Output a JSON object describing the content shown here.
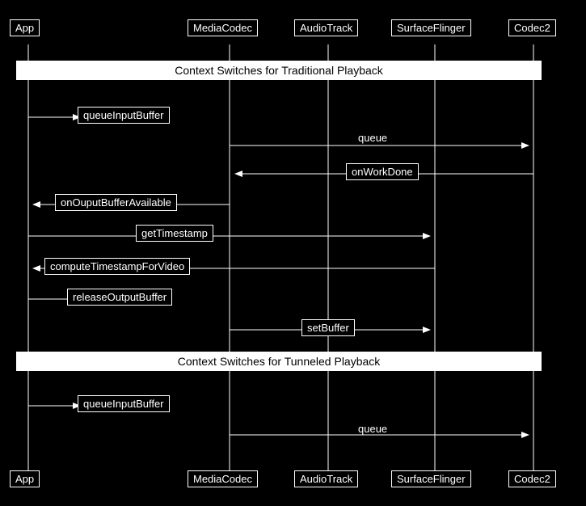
{
  "header": {
    "app": "App",
    "mediacodec": "MediaCodec",
    "audiotrack": "AudioTrack",
    "surfaceflinger": "SurfaceFlinger",
    "codec2": "Codec2"
  },
  "footer": {
    "app": "App",
    "mediacodec": "MediaCodec",
    "audiotrack": "AudioTrack",
    "surfaceflinger": "SurfaceFlinger",
    "codec2": "Codec2"
  },
  "section1": {
    "title": "Context Switches for Traditional Playback"
  },
  "section2": {
    "title": "Context Switches for Tunneled Playback"
  },
  "labels": {
    "queueInputBuffer1": "queueInputBuffer",
    "queue1": "queue",
    "onWorkDone": "onWorkDone",
    "onOuputBufferAvailable": "onOuputBufferAvailable",
    "getTimestamp": "getTimestamp",
    "computeTimestampForVideo": "computeTimestampForVideo",
    "releaseOutputBuffer": "releaseOutputBuffer",
    "setBuffer": "setBuffer",
    "queueInputBuffer2": "queueInputBuffer",
    "queue2": "queue"
  }
}
